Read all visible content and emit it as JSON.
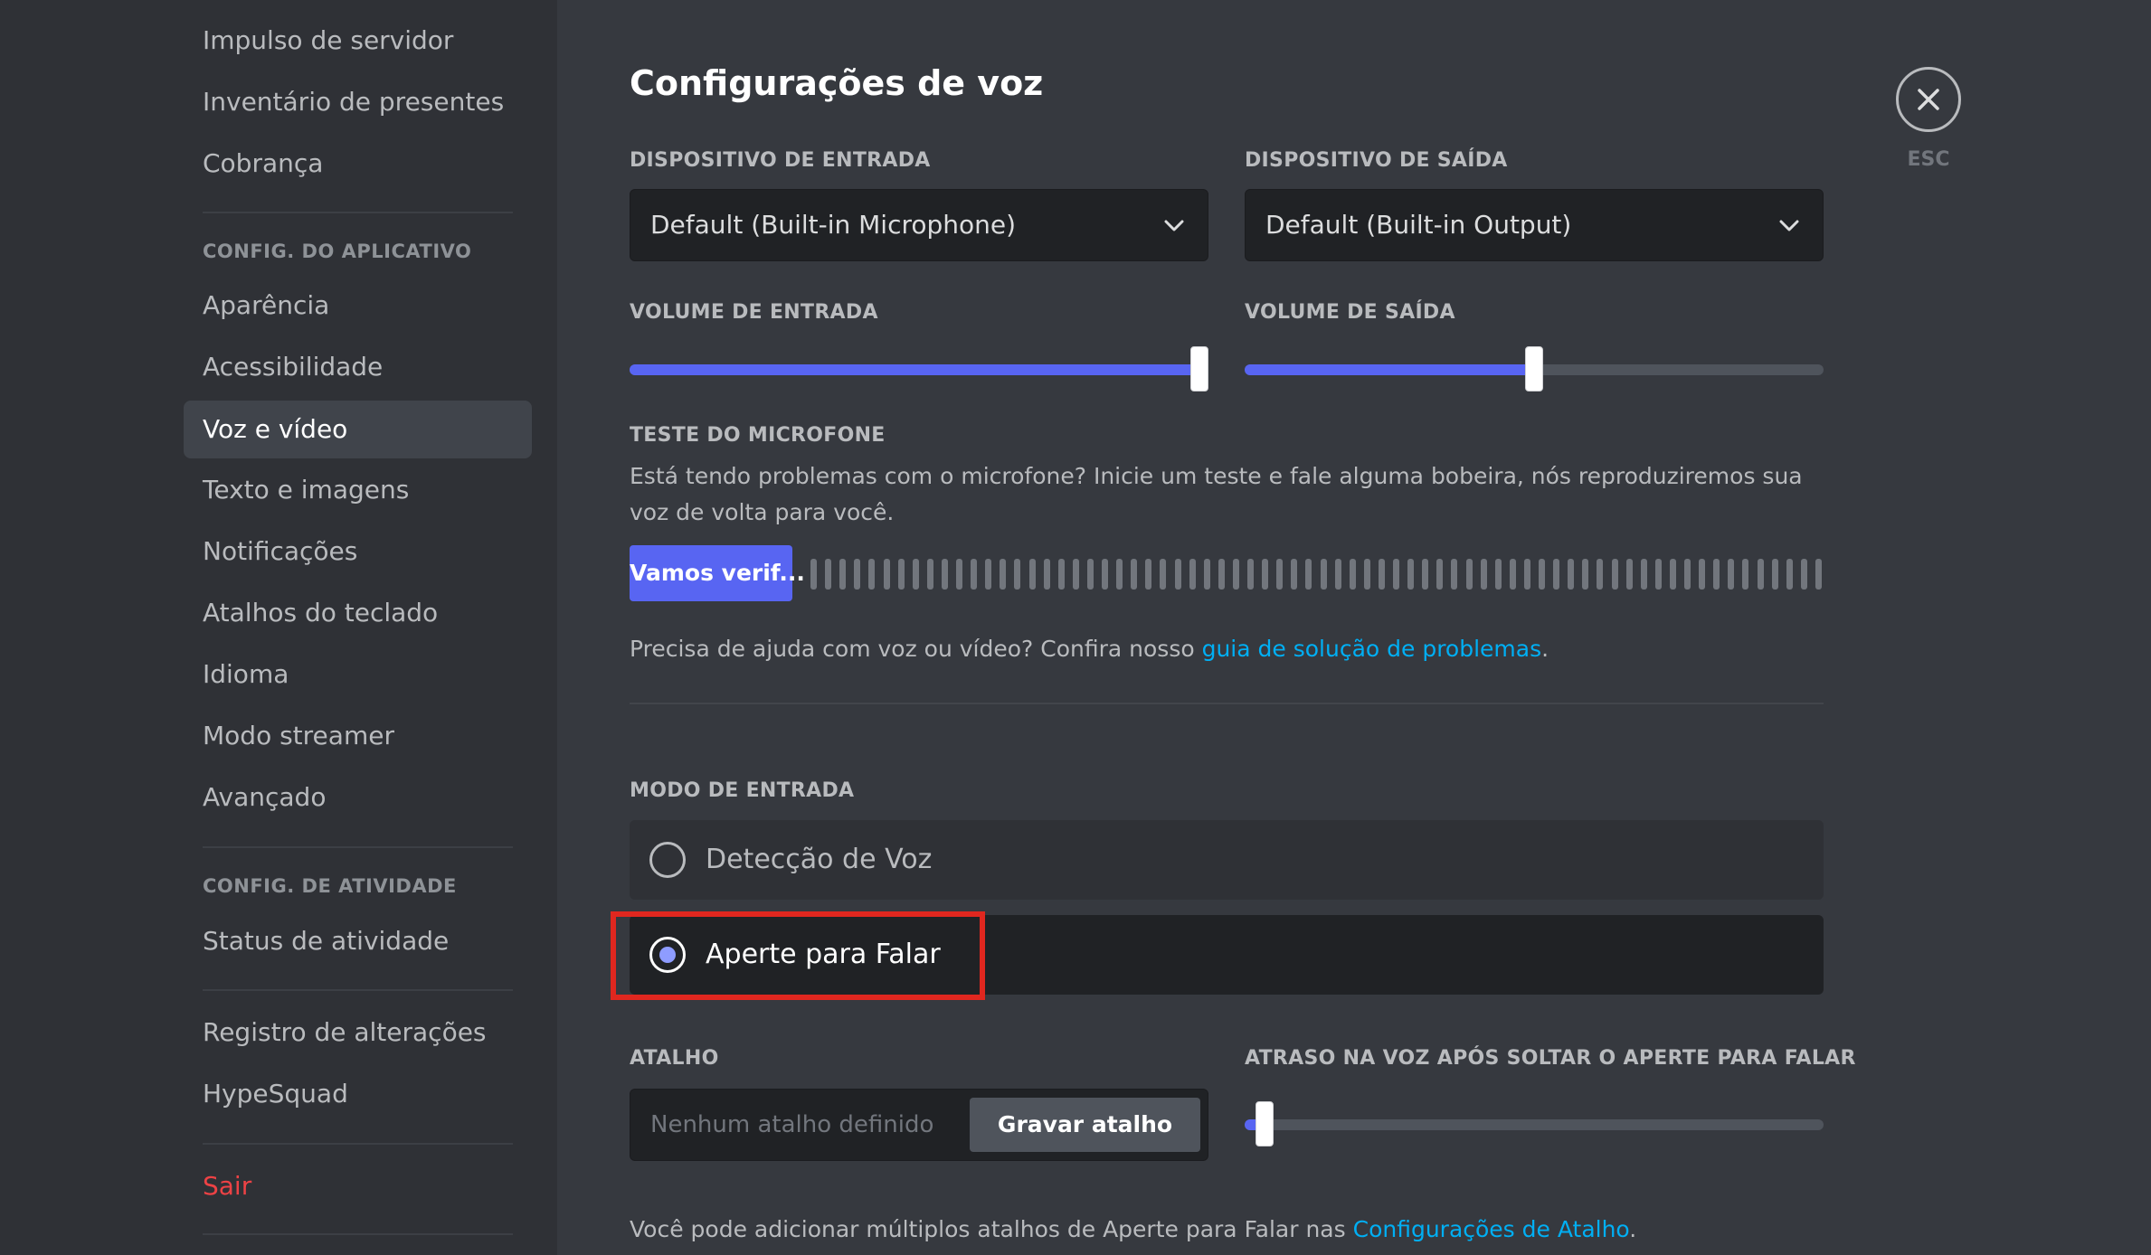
{
  "sidebar": {
    "top_items": [
      "Impulso de servidor",
      "Inventário de presentes",
      "Cobrança"
    ],
    "app_header": "CONFIG. DO APLICATIVO",
    "app_items": [
      "Aparência",
      "Acessibilidade",
      "Voz e vídeo",
      "Texto e imagens",
      "Notificações",
      "Atalhos do teclado",
      "Idioma",
      "Modo streamer",
      "Avançado"
    ],
    "activity_header": "CONFIG. DE ATIVIDADE",
    "activity_items": [
      "Status de atividade"
    ],
    "misc_items": [
      "Registro de alterações",
      "HypeSquad"
    ],
    "logout": "Sair",
    "active_item": "Voz e vídeo"
  },
  "page": {
    "title": "Configurações de voz",
    "close_label": "ESC"
  },
  "devices": {
    "input_label": "DISPOSITIVO DE ENTRADA",
    "input_value": "Default (Built-in Microphone)",
    "output_label": "DISPOSITIVO DE SAÍDA",
    "output_value": "Default (Built-in Output)"
  },
  "volume": {
    "input_label": "VOLUME DE ENTRADA",
    "input_level": 1.0,
    "output_label": "VOLUME DE SAÍDA",
    "output_level": 0.5
  },
  "mic_test": {
    "label": "TESTE DO MICROFONE",
    "description": "Está tendo problemas com o microfone? Inicie um teste e fale alguma bobeira, nós reproduziremos sua voz de volta para você.",
    "button": "Vamos verif...",
    "help_prefix": "Precisa de ajuda com voz ou vídeo? Confira nosso ",
    "help_link": "guia de solução de problemas",
    "help_suffix": "."
  },
  "input_mode": {
    "label": "MODO DE ENTRADA",
    "options": [
      "Detecção de Voz",
      "Aperte para Falar"
    ],
    "selected": "Aperte para Falar"
  },
  "shortcut": {
    "label": "ATALHO",
    "placeholder": "Nenhum atalho definido",
    "record_button": "Gravar atalho",
    "delay_label": "ATRASO NA VOZ APÓS SOLTAR O APERTE PARA FALAR",
    "delay_level": 0.02,
    "footer_prefix": "Você pode adicionar múltiplos atalhos de Aperte para Falar nas ",
    "footer_link": "Configurações de Atalho",
    "footer_suffix": "."
  },
  "colors": {
    "accent": "#5865f2",
    "link": "#00aff4",
    "danger": "#ed4245",
    "highlight": "#e0271f"
  }
}
